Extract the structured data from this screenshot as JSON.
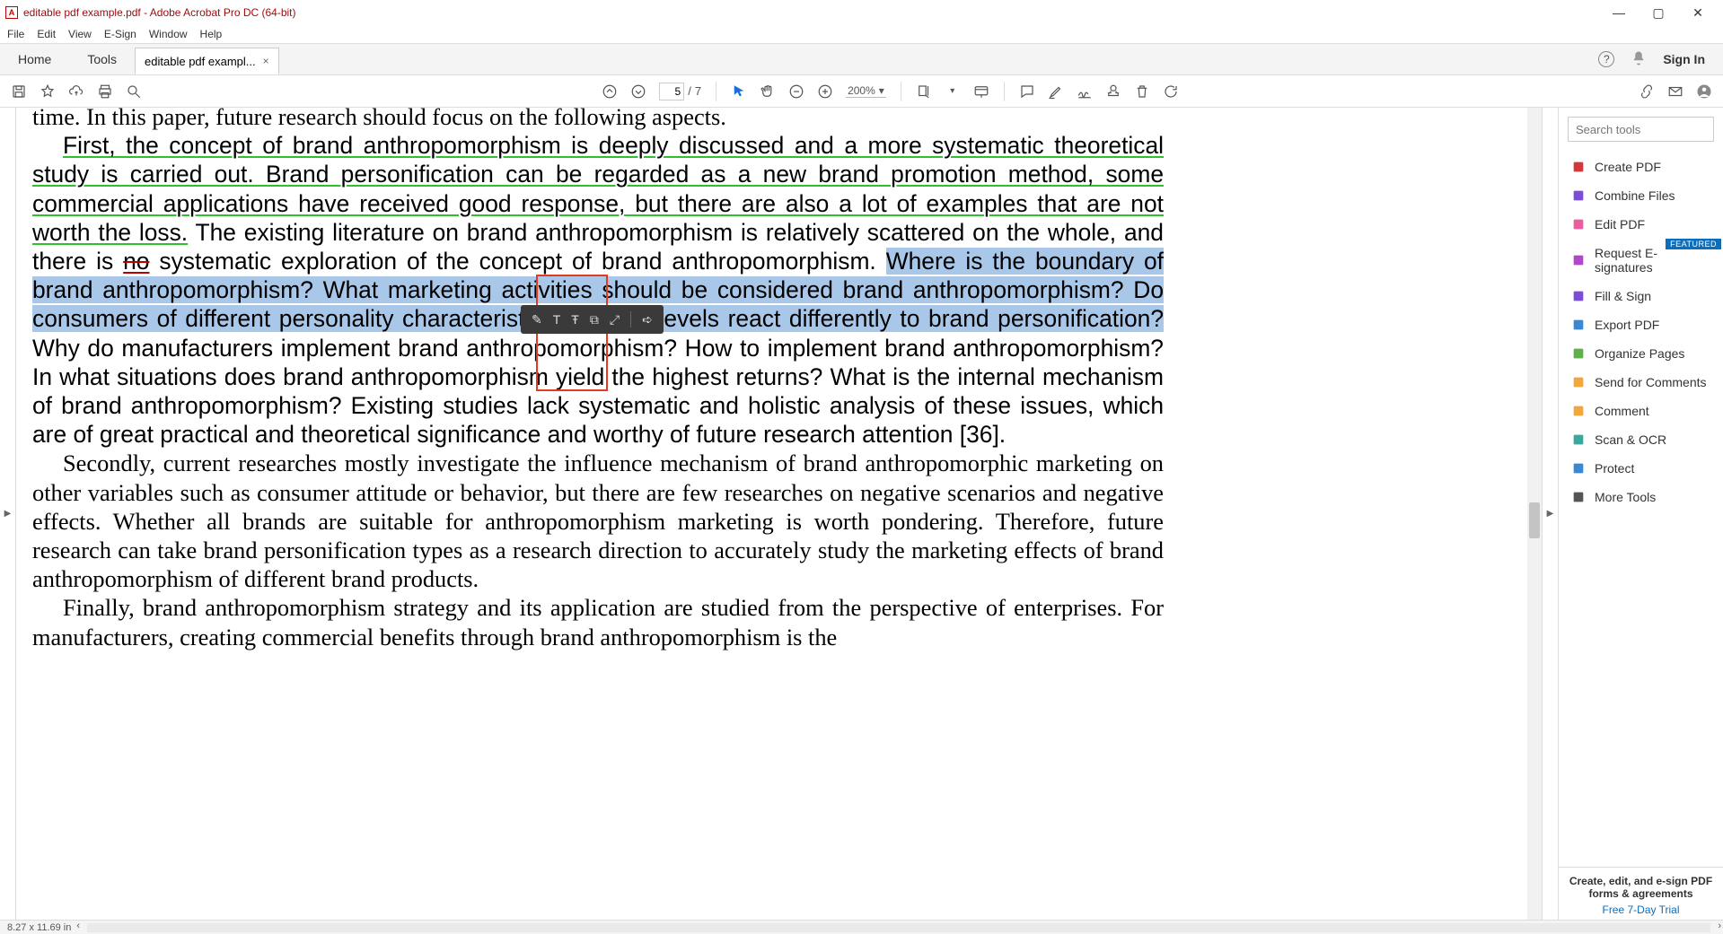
{
  "window": {
    "title": "editable pdf example.pdf - Adobe Acrobat Pro DC (64-bit)",
    "min": "—",
    "max": "▢",
    "close": "✕"
  },
  "menu": [
    "File",
    "Edit",
    "View",
    "E-Sign",
    "Window",
    "Help"
  ],
  "tabs": {
    "home": "Home",
    "tools": "Tools",
    "doc": "editable pdf exampl...",
    "close": "×",
    "help": "?",
    "bell": "🔔",
    "signin": "Sign In"
  },
  "toolbar": {
    "page_current": "5",
    "page_sep": "/",
    "page_total": "7",
    "zoom": "200%",
    "zoom_caret": "▾"
  },
  "doc": {
    "line1": "time. In this paper, future research should focus on the following aspects.",
    "p2_green": "First, the concept of brand anthropomorphism is deeply discussed and a more systematic theoretical study is carried out. Brand personification can be regarded as a new brand promotion method, some commercial applications have received good response, but there are also a lot of examples that are not worth the loss.",
    "p2_after_green_a": " The existing literature on brand anthropomorphism is relatively scattered on the whole, and there is ",
    "p2_struck": "no",
    "p2_after_green_b": " systematic exploration of the concept of brand anthropomorphism. ",
    "p2_sel": "Where is the boundary of brand anthropomorphism? What marketing activities should be considered brand anthropomorphism? Do consumers of different personality characteristics and age levels react differently to brand personification?",
    "p2_tail": " Why do manufacturers implement brand anthropomorphism? How to implement brand anthropomorphism? In what situations does brand anthropomorphism yield the highest returns? What is the internal mechanism of brand anthropomorphism? Existing studies lack systematic and holistic analysis of these issues, which are of great practical and theoretical significance and worthy of future research attention [36].",
    "p3": "Secondly, current researches mostly investigate the influence mechanism of brand anthropomorphic marketing on other variables such as consumer attitude or behavior, but there are few researches on negative scenarios and negative effects. Whether all brands are suitable for anthropomorphism marketing is worth pondering. Therefore, future research can take brand personification types as a research direction to accurately study the marketing effects of brand anthropomorphism of different brand products.",
    "p4": "Finally, brand anthropomorphism strategy and its application are studied from the perspective of enterprises. For manufacturers, creating commercial benefits through brand anthropomorphism is the"
  },
  "floatbar": {
    "highlight": "✎",
    "text": "T",
    "strike": "Ŧ",
    "copy": "⧉",
    "resize": "⤢",
    "more": "➪"
  },
  "right": {
    "search_placeholder": "Search tools",
    "items": [
      {
        "label": "Create PDF",
        "color": "#d23a3a"
      },
      {
        "label": "Combine Files",
        "color": "#7a4fd6"
      },
      {
        "label": "Edit PDF",
        "color": "#e85ea0"
      },
      {
        "label": "Request E-signatures",
        "color": "#b048c9",
        "badge": "FEATURED"
      },
      {
        "label": "Fill & Sign",
        "color": "#7a4fd6"
      },
      {
        "label": "Export PDF",
        "color": "#3a87d2"
      },
      {
        "label": "Organize Pages",
        "color": "#5fb04a"
      },
      {
        "label": "Send for Comments",
        "color": "#f2a73b"
      },
      {
        "label": "Comment",
        "color": "#f2a73b"
      },
      {
        "label": "Scan & OCR",
        "color": "#3aa89e"
      },
      {
        "label": "Protect",
        "color": "#3a87d2"
      },
      {
        "label": "More Tools",
        "color": "#555555"
      }
    ],
    "promo_headline": "Create, edit, and e-sign PDF forms & agreements",
    "promo_link": "Free 7-Day Trial"
  },
  "status": {
    "dims": "8.27 x 11.69 in"
  }
}
